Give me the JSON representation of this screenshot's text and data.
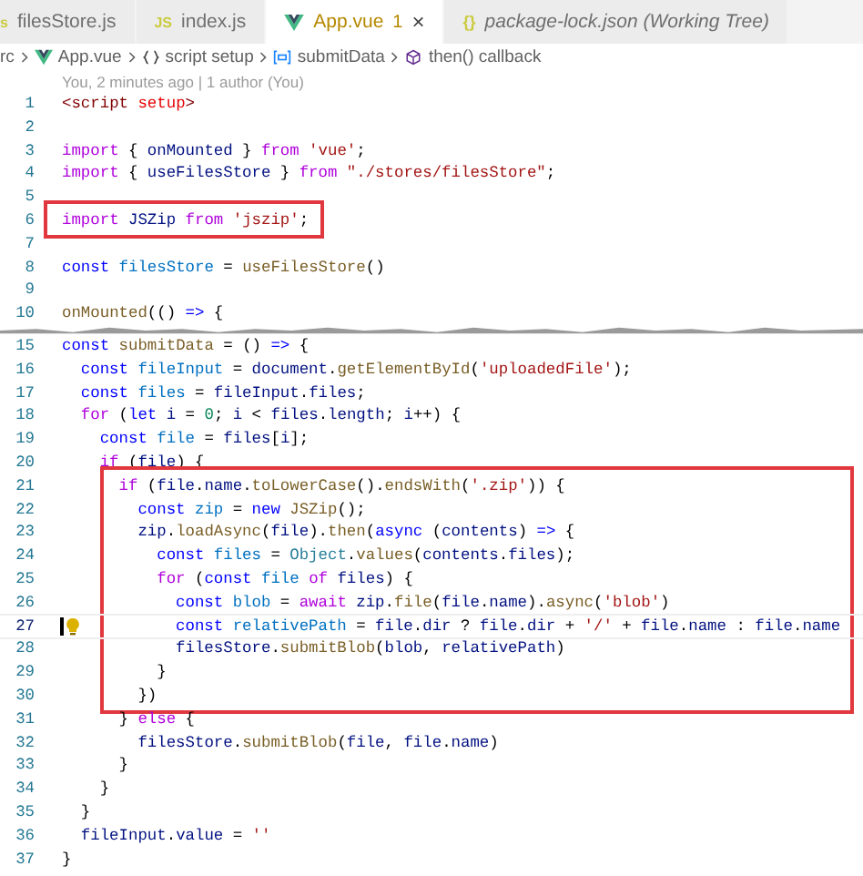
{
  "tabs": [
    {
      "label": "filesStore.js",
      "icon": "s",
      "kind": "js",
      "italic": false,
      "selected": false
    },
    {
      "label": "index.js",
      "icon": "JS",
      "kind": "js",
      "italic": false,
      "selected": false
    },
    {
      "label": "App.vue",
      "kind": "vue",
      "italic": false,
      "selected": true,
      "badge": "1",
      "close": "×"
    },
    {
      "label": "package-lock.json (Working Tree)",
      "icon": "{}",
      "kind": "json",
      "italic": true,
      "selected": false
    }
  ],
  "breadcrumb": [
    {
      "label": "rc",
      "kind": "folder"
    },
    {
      "label": "App.vue",
      "kind": "vue"
    },
    {
      "label": "script setup",
      "kind": "braces"
    },
    {
      "label": "submitData",
      "kind": "variable"
    },
    {
      "label": "then() callback",
      "kind": "method"
    }
  ],
  "blame": "You, 2 minutes ago | 1 author (You)",
  "blocks": [
    {
      "highlighted": false,
      "lines": [
        {
          "kind": "code",
          "number": "1",
          "current": false,
          "tokens": [
            {
              "text": "<script",
              "kind": "tag"
            },
            {
              "text": " setup",
              "kind": "attr"
            },
            {
              "text": ">",
              "kind": "tag"
            }
          ]
        },
        {
          "kind": "code",
          "number": "2",
          "current": false
        },
        {
          "kind": "code",
          "number": "3",
          "current": false,
          "tokens": [
            {
              "text": "import",
              "kind": "ctl"
            },
            " { ",
            {
              "text": "onMounted",
              "kind": "var"
            },
            " } ",
            {
              "text": "from",
              "kind": "ctl"
            },
            {
              "text": " 'vue'",
              "kind": "str"
            },
            ";"
          ]
        },
        {
          "kind": "code",
          "number": "4",
          "current": false,
          "tokens": [
            {
              "text": "import",
              "kind": "ctl"
            },
            " { ",
            {
              "text": "useFilesStore",
              "kind": "var"
            },
            " } ",
            {
              "text": "from",
              "kind": "ctl"
            },
            {
              "text": " \"./stores/filesStore\"",
              "kind": "str"
            },
            ";"
          ]
        },
        {
          "kind": "code",
          "number": "5",
          "current": false
        }
      ]
    },
    {
      "highlighted": true,
      "lines": [
        {
          "kind": "code",
          "number": "6",
          "current": false,
          "tokens": [
            {
              "text": "import",
              "kind": "ctl"
            },
            {
              "text": " JSZip",
              "kind": "var"
            },
            {
              "text": " from",
              "kind": "ctl"
            },
            {
              "text": " 'jszip'",
              "kind": "str"
            },
            ";"
          ]
        }
      ]
    },
    {
      "highlighted": false,
      "lines": [
        {
          "kind": "code",
          "number": "7",
          "current": false
        },
        {
          "kind": "code",
          "number": "8",
          "current": false,
          "tokens": [
            {
              "text": "const",
              "kind": "kw"
            },
            {
              "text": " filesStore",
              "kind": "const"
            },
            " = ",
            {
              "text": "useFilesStore",
              "kind": "fn"
            },
            "()"
          ]
        },
        {
          "kind": "code",
          "number": "9",
          "current": false
        },
        {
          "kind": "code",
          "number": "10",
          "current": false,
          "tokens": [
            {
              "text": "onMounted",
              "kind": "fn"
            },
            "(() ",
            {
              "text": "=>",
              "kind": "kw"
            },
            " {"
          ]
        },
        {
          "kind": "tear"
        },
        {
          "kind": "code",
          "number": "15",
          "current": false,
          "tokens": [
            {
              "text": "const",
              "kind": "kw"
            },
            {
              "text": " submitData",
              "kind": "fn"
            },
            " = () ",
            {
              "text": "=>",
              "kind": "kw"
            },
            " {"
          ]
        },
        {
          "kind": "code",
          "number": "16",
          "current": false,
          "tokens": [
            {
              "text": "  const",
              "kind": "kw"
            },
            {
              "text": " fileInput",
              "kind": "const"
            },
            " = ",
            {
              "text": "document",
              "kind": "var"
            },
            ".",
            {
              "text": "getElementById",
              "kind": "fn"
            },
            "(",
            {
              "text": "'uploadedFile'",
              "kind": "str"
            },
            ");"
          ]
        },
        {
          "kind": "code",
          "number": "17",
          "current": false,
          "tokens": [
            {
              "text": "  const",
              "kind": "kw"
            },
            {
              "text": " files",
              "kind": "const"
            },
            " = ",
            {
              "text": "fileInput",
              "kind": "var"
            },
            ".",
            {
              "text": "files",
              "kind": "var"
            },
            ";"
          ]
        },
        {
          "kind": "code",
          "number": "18",
          "current": false,
          "tokens": [
            {
              "text": "  for",
              "kind": "ctl"
            },
            " (",
            {
              "text": "let",
              "kind": "kw"
            },
            {
              "text": " i",
              "kind": "var"
            },
            " = ",
            {
              "text": "0",
              "kind": "num"
            },
            "; ",
            {
              "text": "i",
              "kind": "var"
            },
            " < ",
            {
              "text": "files",
              "kind": "var"
            },
            ".",
            {
              "text": "length",
              "kind": "var"
            },
            "; ",
            {
              "text": "i",
              "kind": "var"
            },
            "++) {"
          ]
        },
        {
          "kind": "code",
          "number": "19",
          "current": false,
          "tokens": [
            {
              "text": "    const",
              "kind": "kw"
            },
            {
              "text": " file",
              "kind": "const"
            },
            " = ",
            {
              "text": "files",
              "kind": "var"
            },
            "[",
            {
              "text": "i",
              "kind": "var"
            },
            "];"
          ]
        },
        {
          "kind": "code",
          "number": "20",
          "current": false,
          "tokens": [
            {
              "text": "    if",
              "kind": "ctl"
            },
            " (",
            {
              "text": "file",
              "kind": "var"
            },
            ") {"
          ]
        }
      ]
    },
    {
      "highlighted": true,
      "lines": [
        {
          "kind": "code",
          "number": "21",
          "current": false,
          "tokens": [
            {
              "text": "      if",
              "kind": "ctl"
            },
            " (",
            {
              "text": "file",
              "kind": "var"
            },
            ".",
            {
              "text": "name",
              "kind": "var"
            },
            ".",
            {
              "text": "toLowerCase",
              "kind": "fn"
            },
            "().",
            {
              "text": "endsWith",
              "kind": "fn"
            },
            "(",
            {
              "text": "'.zip'",
              "kind": "str"
            },
            ")) {"
          ]
        },
        {
          "kind": "code",
          "number": "22",
          "current": false,
          "tokens": [
            {
              "text": "        const",
              "kind": "kw"
            },
            {
              "text": " zip",
              "kind": "const"
            },
            " = ",
            {
              "text": "new",
              "kind": "kw"
            },
            {
              "text": " JSZip",
              "kind": "fn"
            },
            "();"
          ]
        },
        {
          "kind": "code",
          "number": "23",
          "current": false,
          "tokens": [
            {
              "text": "        zip",
              "kind": "var"
            },
            ".",
            {
              "text": "loadAsync",
              "kind": "fn"
            },
            "(",
            {
              "text": "file",
              "kind": "var"
            },
            ").",
            {
              "text": "then",
              "kind": "fn"
            },
            "(",
            {
              "text": "async",
              "kind": "kw"
            },
            " (",
            {
              "text": "contents",
              "kind": "var"
            },
            ") ",
            {
              "text": "=>",
              "kind": "kw"
            },
            " {"
          ]
        },
        {
          "kind": "code",
          "number": "24",
          "current": false,
          "tokens": [
            {
              "text": "          const",
              "kind": "kw"
            },
            {
              "text": " files",
              "kind": "const"
            },
            " = ",
            {
              "text": "Object",
              "kind": "type"
            },
            ".",
            {
              "text": "values",
              "kind": "fn"
            },
            "(",
            {
              "text": "contents",
              "kind": "var"
            },
            ".",
            {
              "text": "files",
              "kind": "var"
            },
            ");"
          ]
        },
        {
          "kind": "code",
          "number": "25",
          "current": false,
          "tokens": [
            {
              "text": "          for",
              "kind": "ctl"
            },
            " (",
            {
              "text": "const",
              "kind": "kw"
            },
            {
              "text": " file",
              "kind": "const"
            },
            {
              "text": " of",
              "kind": "ctl"
            },
            {
              "text": " files",
              "kind": "var"
            },
            ") {"
          ]
        },
        {
          "kind": "code",
          "number": "26",
          "current": false,
          "tokens": [
            {
              "text": "            const",
              "kind": "kw"
            },
            {
              "text": " blob",
              "kind": "const"
            },
            " = ",
            {
              "text": "await",
              "kind": "ctl"
            },
            {
              "text": " zip",
              "kind": "var"
            },
            ".",
            {
              "text": "file",
              "kind": "fn"
            },
            "(",
            {
              "text": "file",
              "kind": "var"
            },
            ".",
            {
              "text": "name",
              "kind": "var"
            },
            ").",
            {
              "text": "async",
              "kind": "fn"
            },
            "(",
            {
              "text": "'blob'",
              "kind": "str"
            },
            ")"
          ]
        },
        {
          "kind": "code",
          "number": "27",
          "current": true,
          "tokens": [
            {
              "text": "            const",
              "kind": "kw"
            },
            {
              "text": " relativePath",
              "kind": "const"
            },
            " = ",
            {
              "text": "file",
              "kind": "var"
            },
            ".",
            {
              "text": "dir",
              "kind": "var"
            },
            " ? ",
            {
              "text": "file",
              "kind": "var"
            },
            ".",
            {
              "text": "dir",
              "kind": "var"
            },
            " + ",
            {
              "text": "'/'",
              "kind": "str"
            },
            " + ",
            {
              "text": "file",
              "kind": "var"
            },
            ".",
            {
              "text": "name",
              "kind": "var"
            },
            " : ",
            {
              "text": "file",
              "kind": "var"
            },
            ".",
            {
              "text": "name",
              "kind": "var"
            }
          ]
        },
        {
          "kind": "code",
          "number": "28",
          "current": false,
          "tokens": [
            {
              "text": "            filesStore",
              "kind": "var"
            },
            ".",
            {
              "text": "submitBlob",
              "kind": "fn"
            },
            "(",
            {
              "text": "blob",
              "kind": "var"
            },
            ", ",
            {
              "text": "relativePath",
              "kind": "var"
            },
            ")"
          ]
        },
        {
          "kind": "code",
          "number": "29",
          "current": false,
          "tokens": [
            "          }"
          ]
        },
        {
          "kind": "code",
          "number": "30",
          "current": false,
          "tokens": [
            "        })"
          ]
        }
      ]
    },
    {
      "highlighted": false,
      "lines": [
        {
          "kind": "code",
          "number": "31",
          "current": false,
          "tokens": [
            "      } ",
            {
              "text": "else",
              "kind": "ctl"
            },
            " {"
          ]
        },
        {
          "kind": "code",
          "number": "32",
          "current": false,
          "tokens": [
            {
              "text": "        filesStore",
              "kind": "var"
            },
            ".",
            {
              "text": "submitBlob",
              "kind": "fn"
            },
            "(",
            {
              "text": "file",
              "kind": "var"
            },
            ", ",
            {
              "text": "file",
              "kind": "var"
            },
            ".",
            {
              "text": "name",
              "kind": "var"
            },
            ")"
          ]
        },
        {
          "kind": "code",
          "number": "33",
          "current": false,
          "tokens": [
            "      }"
          ]
        },
        {
          "kind": "code",
          "number": "34",
          "current": false,
          "tokens": [
            "    }"
          ]
        },
        {
          "kind": "code",
          "number": "35",
          "current": false,
          "tokens": [
            "  }"
          ]
        },
        {
          "kind": "code",
          "number": "36",
          "current": false,
          "tokens": [
            {
              "text": "  fileInput",
              "kind": "var"
            },
            ".",
            {
              "text": "value",
              "kind": "var"
            },
            " = ",
            {
              "text": "''",
              "kind": "str"
            }
          ]
        },
        {
          "kind": "code",
          "number": "37",
          "current": false,
          "tokens": [
            "}"
          ]
        }
      ]
    }
  ]
}
